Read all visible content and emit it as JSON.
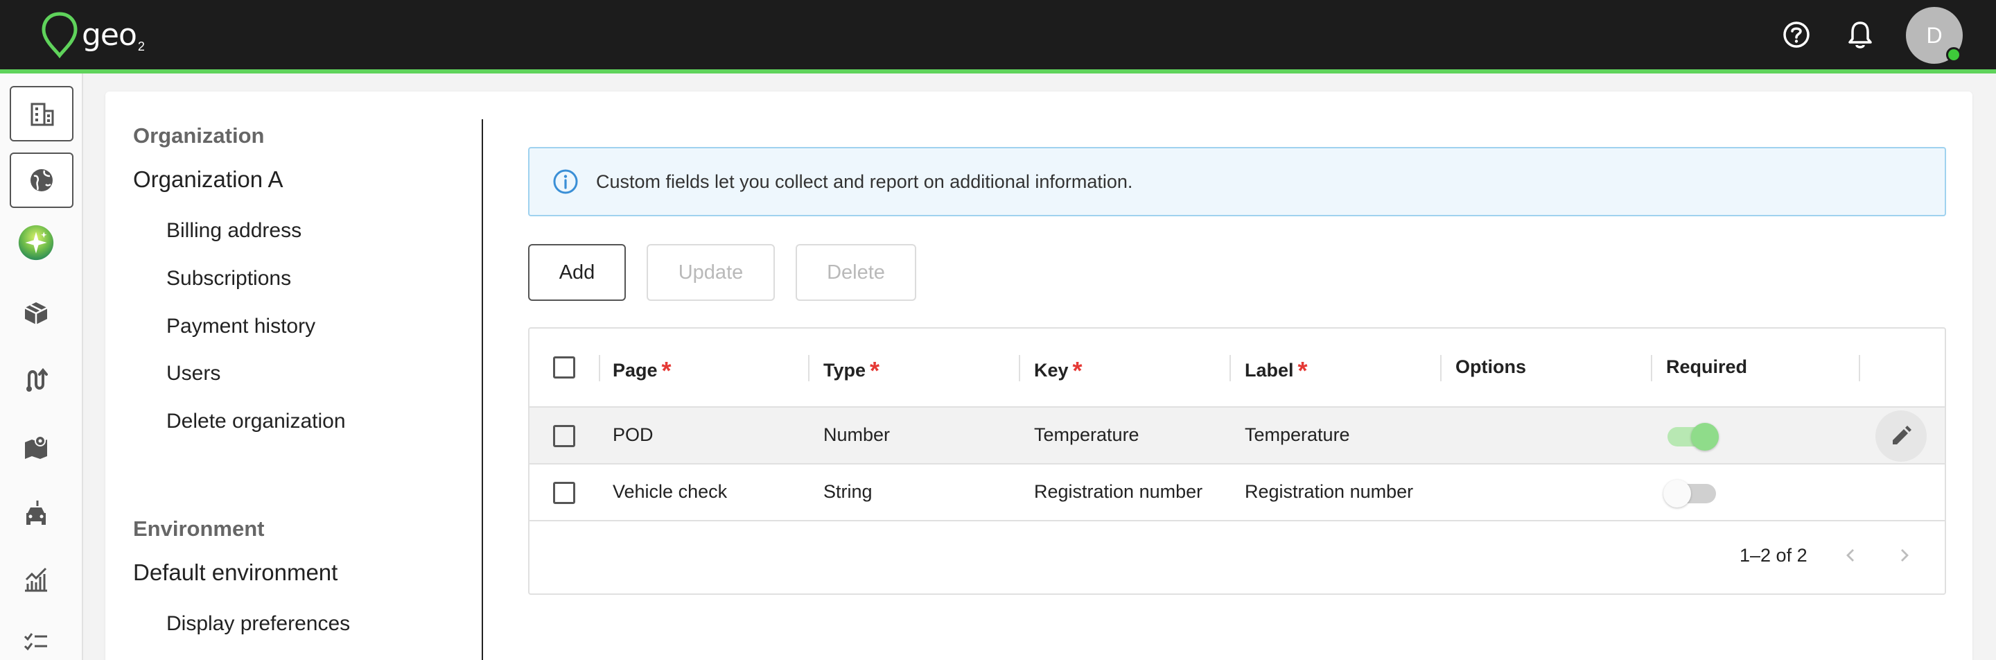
{
  "topbar": {
    "logo_text": "geo",
    "logo_sub": "2",
    "help_icon": "help-circle-icon",
    "notifications_icon": "bell-icon",
    "avatar_initial": "D",
    "accent_color": "#5fd35b"
  },
  "rail": {
    "items": [
      {
        "name": "organization",
        "icon": "building-icon"
      },
      {
        "name": "environment",
        "icon": "globe-icon"
      },
      {
        "name": "assistant",
        "icon": "sparkle-icon"
      },
      {
        "name": "packages",
        "icon": "package-icon"
      },
      {
        "name": "routes",
        "icon": "route-icon"
      },
      {
        "name": "maps",
        "icon": "map-icon"
      },
      {
        "name": "vehicles",
        "icon": "vehicle-icon"
      },
      {
        "name": "analytics",
        "icon": "chart-icon"
      },
      {
        "name": "tasks",
        "icon": "checklist-icon"
      }
    ]
  },
  "settings_nav": {
    "org_heading": "Organization",
    "org_name": "Organization A",
    "org_items": [
      "Billing address",
      "Subscriptions",
      "Payment history",
      "Users",
      "Delete organization"
    ],
    "env_heading": "Environment",
    "env_name": "Default environment",
    "env_items": [
      "Display preferences"
    ]
  },
  "banner": {
    "icon": "info-icon",
    "text": "Custom fields let you collect and report on additional information."
  },
  "toolbar": {
    "add_label": "Add",
    "update_label": "Update",
    "delete_label": "Delete"
  },
  "table": {
    "columns": [
      "Page",
      "Type",
      "Key",
      "Label",
      "Options",
      "Required"
    ],
    "required_mark": "*",
    "rows": [
      {
        "page": "POD",
        "type": "Number",
        "key": "Temperature",
        "label": "Temperature",
        "options": "",
        "required": true
      },
      {
        "page": "Vehicle check",
        "type": "String",
        "key": "Registration number",
        "label": "Registration number",
        "options": "",
        "required": false
      }
    ],
    "pagination": "1–2 of 2"
  }
}
